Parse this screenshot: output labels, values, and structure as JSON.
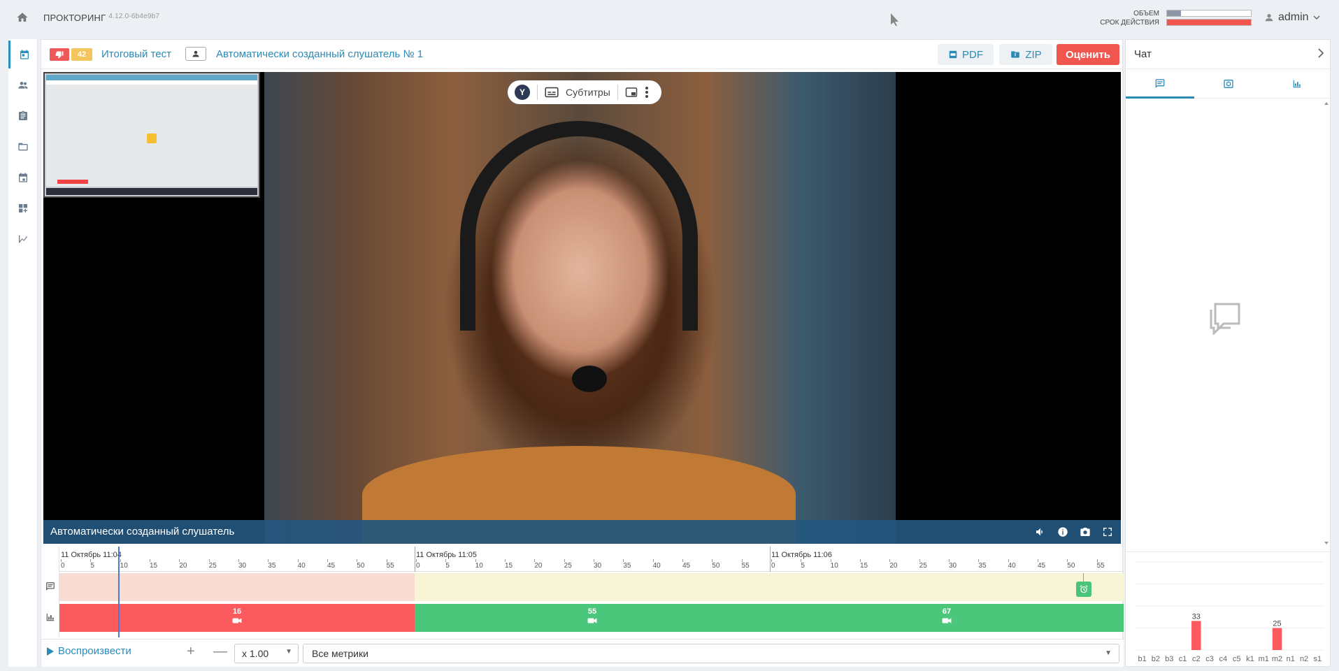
{
  "app": {
    "title": "ПРОКТОРИНГ",
    "version": "4.12.0-6b4e9b7"
  },
  "quota": {
    "volume_label": "ОБЪЕМ",
    "validity_label": "СРОК ДЕЙСТВИЯ",
    "volume_fraction": 0.17,
    "validity_fraction": 1.0,
    "volume_color": "#8a97a6",
    "validity_color": "#f0554e"
  },
  "user": {
    "name": "admin"
  },
  "rail": {
    "items": [
      {
        "icon": "calendar-check-icon",
        "active": true
      },
      {
        "icon": "users-icon",
        "active": false
      },
      {
        "icon": "clipboard-icon",
        "active": false
      },
      {
        "icon": "folder-icon",
        "active": false
      },
      {
        "icon": "calendar-icon",
        "active": false
      },
      {
        "icon": "dashboard-add-icon",
        "active": false
      },
      {
        "icon": "analytics-icon",
        "active": false
      }
    ]
  },
  "session": {
    "badge_count": "42",
    "test_name": "Итоговый тест",
    "listener_name": "Автоматически созданный слушатель № 1",
    "pdf_label": "PDF",
    "zip_label": "ZIP",
    "rate_label": "Оценить"
  },
  "video": {
    "subtitles_label": "Субтитры",
    "caption": "Автоматически созданный слушатель"
  },
  "timeline": {
    "minutes": [
      {
        "label": "11 Октябрь 11:04"
      },
      {
        "label": "11 Октябрь 11:05"
      },
      {
        "label": "11 Октябрь 11:06"
      }
    ],
    "ticks": [
      "0",
      "5",
      "10",
      "15",
      "20",
      "25",
      "30",
      "35",
      "40",
      "45",
      "50",
      "55"
    ],
    "segments": [
      {
        "value": "16",
        "color": "#fb5a5e"
      },
      {
        "value": "55",
        "color": "#4bc77b"
      },
      {
        "value": "67",
        "color": "#4bc77b"
      }
    ]
  },
  "controls": {
    "play_label": "Воспроизвести",
    "plus_label": "+",
    "minus_label": "—",
    "speed": "x 1.00",
    "metrics": "Все метрики"
  },
  "right_panel": {
    "title": "Чат",
    "tabs": [
      {
        "icon": "chat-icon",
        "active": true
      },
      {
        "icon": "alarm-icon",
        "active": false
      },
      {
        "icon": "bar-chart-icon",
        "active": false
      }
    ]
  },
  "chart_data": {
    "type": "bar",
    "categories": [
      "b1",
      "b2",
      "b3",
      "c1",
      "c2",
      "c3",
      "c4",
      "c5",
      "k1",
      "m1",
      "m2",
      "n1",
      "n2",
      "s1"
    ],
    "values": [
      0,
      0,
      0,
      0,
      33,
      0,
      0,
      0,
      0,
      0,
      25,
      0,
      0,
      0
    ],
    "data_labels": [
      "",
      "",
      "",
      "",
      "33",
      "",
      "",
      "",
      "",
      "",
      "25",
      "",
      "",
      ""
    ],
    "bar_color": "#fb5a5e",
    "ylim": [
      0,
      100
    ],
    "grid": true
  }
}
